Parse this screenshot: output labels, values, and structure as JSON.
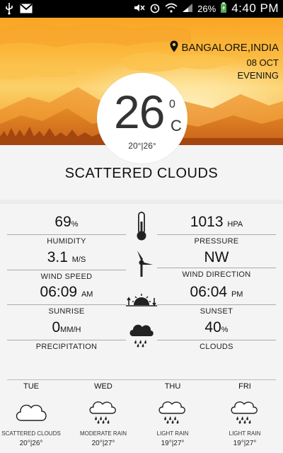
{
  "status_bar": {
    "battery": "26%",
    "time": "4:40 PM"
  },
  "location": {
    "city": "BANGALORE,INDIA",
    "date": "08 OCT",
    "period": "EVENING"
  },
  "current": {
    "temp": "26",
    "degree_symbol": "0",
    "unit": "C",
    "range": "20°|26°",
    "condition": "SCATTERED CLOUDS"
  },
  "stats": {
    "humidity": {
      "value": "69",
      "unit": "%",
      "label": "HUMIDITY"
    },
    "pressure": {
      "value": "1013",
      "unit": "HPA",
      "label": "PRESSURE"
    },
    "wind_speed": {
      "value": "3.1",
      "unit": "M/S",
      "label": "WIND SPEED"
    },
    "wind_direction": {
      "value": "NW",
      "unit": "",
      "label": "WIND DIRECTION"
    },
    "sunrise": {
      "value": "06:09",
      "unit": "AM",
      "label": "SUNRISE"
    },
    "sunset": {
      "value": "06:04",
      "unit": "PM",
      "label": "SUNSET"
    },
    "precipitation": {
      "value": "0",
      "unit": "MM/H",
      "label": "PRECIPITATION"
    },
    "clouds": {
      "value": "40",
      "unit": "%",
      "label": "CLOUDS"
    }
  },
  "icons": {
    "center_1": "thermometer-icon",
    "center_2": "wind-turbine-icon",
    "center_3": "sunrise-sunset-icon",
    "center_4": "rain-cloud-icon"
  },
  "forecast": [
    {
      "day": "TUE",
      "condition": "SCATTERED CLOUDS",
      "range": "20°|26°",
      "icon": "cloud-icon"
    },
    {
      "day": "WED",
      "condition": "MODERATE RAIN",
      "range": "20°|27°",
      "icon": "rain-cloud-icon"
    },
    {
      "day": "THU",
      "condition": "LIGHT RAIN",
      "range": "19°|27°",
      "icon": "rain-cloud-icon"
    },
    {
      "day": "FRI",
      "condition": "LIGHT RAIN",
      "range": "19°|27°",
      "icon": "rain-cloud-icon"
    }
  ],
  "colors": {
    "sky_top": "#f9a525",
    "sky_mid": "#fcd06a",
    "mountains": "#d9701a",
    "accent_text": "#111111"
  }
}
